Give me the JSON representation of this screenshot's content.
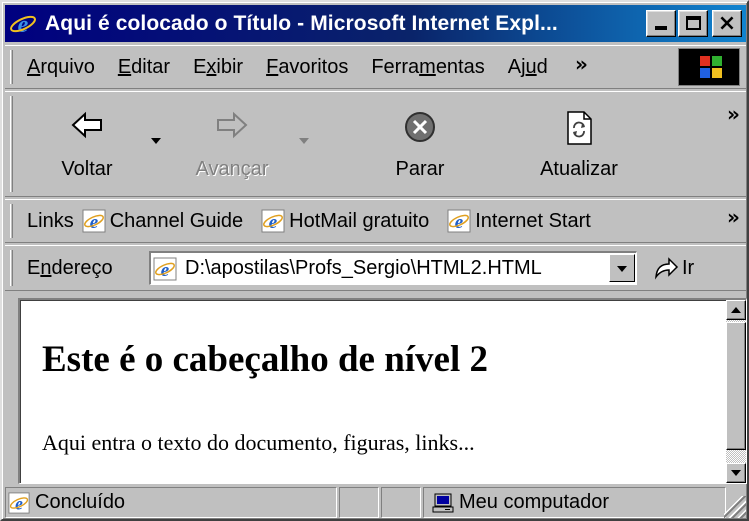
{
  "window": {
    "title": "Aqui é colocado o Título - Microsoft Internet Expl...",
    "controls": {
      "minimize": "minimize",
      "maximize": "maximize",
      "close": "×"
    }
  },
  "menubar": {
    "items": [
      {
        "pre": "",
        "u": "A",
        "post": "rquivo"
      },
      {
        "pre": "",
        "u": "E",
        "post": "ditar"
      },
      {
        "pre": "E",
        "u": "x",
        "post": "ibir"
      },
      {
        "pre": "",
        "u": "F",
        "post": "avoritos"
      },
      {
        "pre": "Ferra",
        "u": "m",
        "post": "entas"
      },
      {
        "pre": "Aj",
        "u": "u",
        "post": "d"
      }
    ],
    "overflow": "»"
  },
  "toolbar": {
    "back": "Voltar",
    "forward": "Avançar",
    "stop": "Parar",
    "refresh": "Atualizar",
    "overflow": "»"
  },
  "links": {
    "label": "Links",
    "items": [
      "Channel Guide",
      "HotMail gratuito",
      "Internet Start"
    ],
    "overflow": "»"
  },
  "address": {
    "label_pre": "E",
    "label_u": "n",
    "label_post": "dereço",
    "value": "D:\\apostilas\\Profs_Sergio\\HTML2.HTML",
    "go": "Ir"
  },
  "document": {
    "heading": "Este é o cabeçalho de nível 2",
    "paragraph": "Aqui entra o texto do documento, figuras, links..."
  },
  "status": {
    "text": "Concluído",
    "zone": "Meu computador"
  },
  "colors": {
    "title_gradient_start": "#000080",
    "title_gradient_end": "#1084d0",
    "face": "#c0c0c0"
  }
}
